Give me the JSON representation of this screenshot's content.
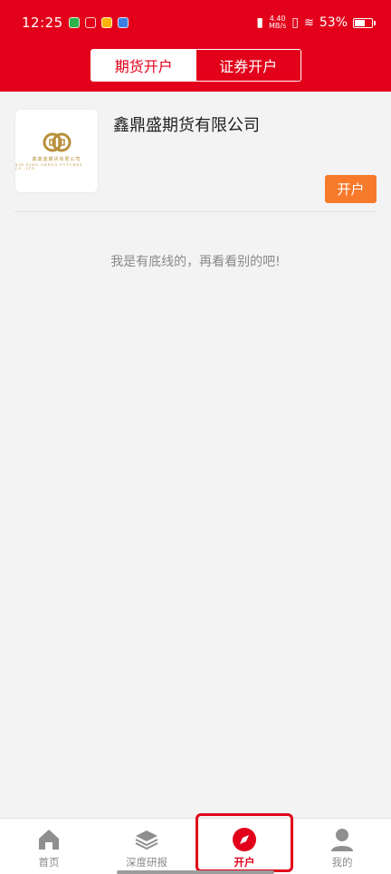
{
  "status": {
    "time": "12:25",
    "network_rate_line1": "4.40",
    "network_rate_line2": "MB/s",
    "battery_percent": "53%"
  },
  "tabs": [
    {
      "label": "期货开户"
    },
    {
      "label": "证券开户"
    }
  ],
  "company": {
    "name": "鑫鼎盛期货有限公司",
    "logo_cn": "鑫鼎盛期货有限公司",
    "logo_en": "XIN DING SHENG FUTURES CO.,LTD",
    "open_button": "开户"
  },
  "end_message": "我是有底线的，再看看别的吧!",
  "nav": {
    "items": [
      {
        "label": "首页",
        "icon": "home-icon"
      },
      {
        "label": "深度研报",
        "icon": "layers-icon"
      },
      {
        "label": "开户",
        "icon": "compass-icon"
      },
      {
        "label": "我的",
        "icon": "user-icon"
      }
    ]
  },
  "colors": {
    "brand_red": "#e2001a",
    "accent_orange": "#f77a2b",
    "logo_gold": "#b98f3b"
  }
}
